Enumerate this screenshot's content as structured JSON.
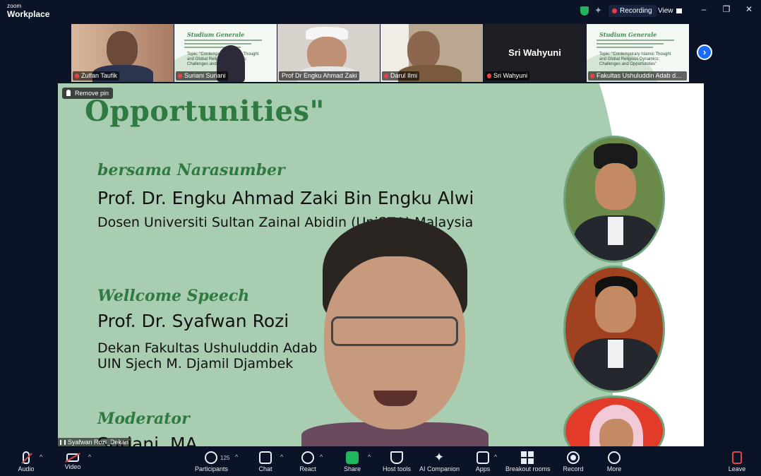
{
  "app": {
    "logo_top": "zoom",
    "logo_bottom": "Workplace"
  },
  "titlebar": {
    "recording": "Recording",
    "view": "View",
    "minimize": "–",
    "restore": "❐",
    "close": "✕"
  },
  "thumbnails": [
    {
      "name": "Zulfan Taufik",
      "muted": true
    },
    {
      "name": "Suriani Suriani",
      "muted": true,
      "kind": "slide"
    },
    {
      "name": "Prof Dr Engku Ahmad Zaki",
      "muted": false
    },
    {
      "name": "Darul Ilmi",
      "muted": true
    },
    {
      "name": "Sri Wahyuni",
      "muted": true,
      "display_name": "Sri Wahyuni"
    },
    {
      "name": "Fakultas Ushuluddin Adab dan ...",
      "muted": true,
      "kind": "slide"
    }
  ],
  "mini_slide": {
    "title": "Studium Generale",
    "topic": "Topic: \"Contemporary Islamic Thought and Global Religious Dynamics: Challenges and Opportunities\""
  },
  "stage": {
    "pin_label": "Remove pin",
    "title_line": "Opportunities\"",
    "sections": [
      {
        "heading": "bersama Narasumber",
        "name": "Prof. Dr. Engku Ahmad Zaki Bin Engku Alwi",
        "desc": [
          "Dosen Universiti Sultan Zainal Abidin (UniSZA) Malaysia"
        ]
      },
      {
        "heading": "Wellcome Speech",
        "name": "Prof. Dr. Syafwan Rozi",
        "desc": [
          "Dekan Fakultas Ushuluddin Adab",
          "UIN Sjech M. Djamil Djambek"
        ]
      },
      {
        "heading": "Moderator",
        "name": "Suriani, MA"
      }
    ],
    "speaker_label": "Syafwan Rozi_Dekan"
  },
  "toolbar": {
    "audio": "Audio",
    "video": "Video",
    "participants": "Participants",
    "participant_count": "125",
    "chat": "Chat",
    "react": "React",
    "share": "Share",
    "host_tools": "Host tools",
    "ai_companion": "AI Companion",
    "apps": "Apps",
    "breakout": "Breakout rooms",
    "record": "Record",
    "more": "More",
    "leave": "Leave"
  },
  "colors": {
    "accent": "#1a6cff",
    "share": "#1fb75b",
    "recording": "#ef3b3b",
    "slide_bg": "#a9cdb1",
    "slide_green": "#2f7a41"
  }
}
